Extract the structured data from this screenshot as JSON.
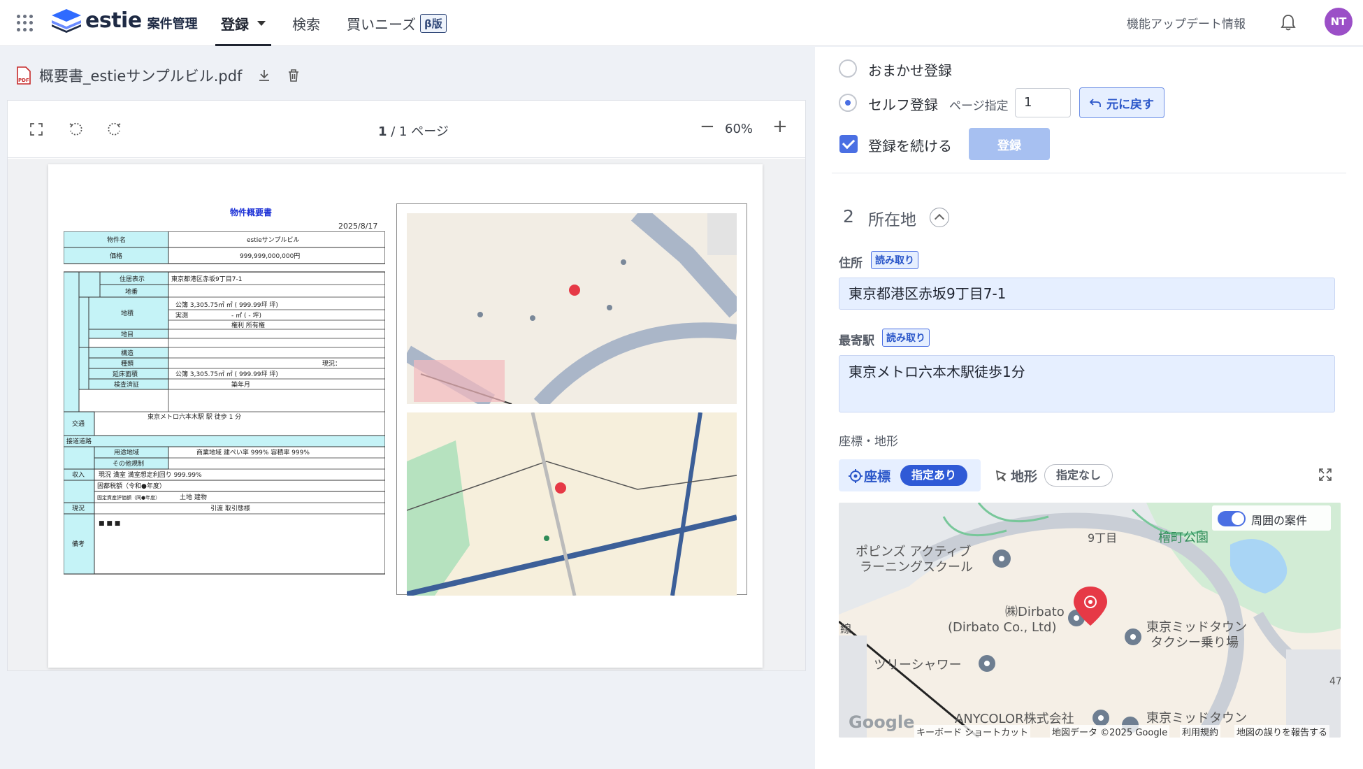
{
  "header": {
    "logo_word": "estie",
    "logo_sub": "案件管理",
    "nav": [
      {
        "label": "登録"
      },
      {
        "label": "検索"
      },
      {
        "label": "買いニーズ",
        "badge": "β版"
      }
    ],
    "update_info": "機能アップデート情報",
    "avatar_initials": "NT",
    "avatar_color": "#9b4fc7"
  },
  "file": {
    "name": "概要書_estieサンプルビル.pdf"
  },
  "viewer": {
    "page_current": "1",
    "page_total_text": "/ 1 ページ",
    "zoom": "60%",
    "zoom_minus": "−",
    "zoom_plus": "+"
  },
  "document": {
    "title": "物件概要書",
    "date": "2025/8/17",
    "rows": [
      {
        "label": "物件名",
        "value": "estieサンプルビル"
      },
      {
        "label": "価格",
        "value": "999,999,000,000円"
      },
      {
        "label": "住居表示",
        "value": "東京都港区赤坂9丁目7-1"
      },
      {
        "label": "地番",
        "value": ""
      },
      {
        "label": "地積",
        "value": "公簿 3,305.75㎡ ㎡ ( 999.99坪 坪)"
      },
      {
        "label": "実測",
        "value": "- ㎡ ( - 坪)"
      },
      {
        "label": "地目",
        "value": "権利 所有権"
      },
      {
        "label": "構造",
        "value": ""
      },
      {
        "label": "種類",
        "value": "現況："
      },
      {
        "label": "延床面積",
        "value": "公簿 3,305.75㎡ ㎡ ( 999.99坪 坪)"
      },
      {
        "label": "検査済証",
        "value": "築年月"
      },
      {
        "label": "交通",
        "value": "東京メトロ六本木駅 駅 徒歩 1 分"
      },
      {
        "label": "接道道路",
        "value": ""
      },
      {
        "label": "用途地域",
        "value": "商業地域 建ぺい率 999% 容積率 999%"
      },
      {
        "label": "その他規制",
        "value": ""
      },
      {
        "label": "収入",
        "value": "現況 満室 満室想定利回り 999.99%"
      },
      {
        "label": "固都税額（令和●年度）",
        "value": ""
      },
      {
        "label": "固定資産評価額（同●年度）",
        "value": "土地 建物"
      },
      {
        "label": "現況",
        "value": "引渡 取引態様"
      },
      {
        "label": "備考",
        "value": "■ ■ ■"
      }
    ]
  },
  "register": {
    "auto_label": "おまかせ登録",
    "self_label": "セルフ登録",
    "page_spec_label": "ページ指定",
    "page_value": "1",
    "revert_label": "元に戻す",
    "continue_label": "登録を続ける",
    "register_label": "登録"
  },
  "section": {
    "num": "2",
    "title": "所在地"
  },
  "fields": {
    "address_label": "住所",
    "read_badge": "読み取り",
    "address_value": "東京都港区赤坂9丁目7-1",
    "station_label": "最寄駅",
    "station_value": "東京メトロ六本木駅徒歩1分",
    "coords_section_label": "座標・地形",
    "coord_tab": "座標",
    "coord_status": "指定あり",
    "shape_tab": "地形",
    "shape_status": "指定なし"
  },
  "map": {
    "toggle_label": "周囲の案件",
    "labels": {
      "park": "檜町公園",
      "block": "9丁目",
      "pool": "ポピンズ アクティブ\nラーニングスクール",
      "dirbato1": "㈱Dirbato",
      "dirbato2": "(Dirbato Co., Ltd)",
      "midtown1": "東京ミッドタウン",
      "midtown2": "タクシー乗り場",
      "tower": "ツリーシャワー",
      "anycolor": "ANYCOLOR株式会社",
      "midtown3": "東京ミッドタウン",
      "line": "線",
      "num47": "47"
    },
    "footer": {
      "google": "Google",
      "shortcuts": "キーボード ショートカット",
      "mapdata": "地図データ ©2025 Google",
      "terms": "利用規約",
      "report": "地図の誤りを報告する"
    }
  },
  "colors": {
    "accent": "#4a6fe3",
    "accent_light": "#e6efff",
    "pin_red": "#e63946"
  }
}
